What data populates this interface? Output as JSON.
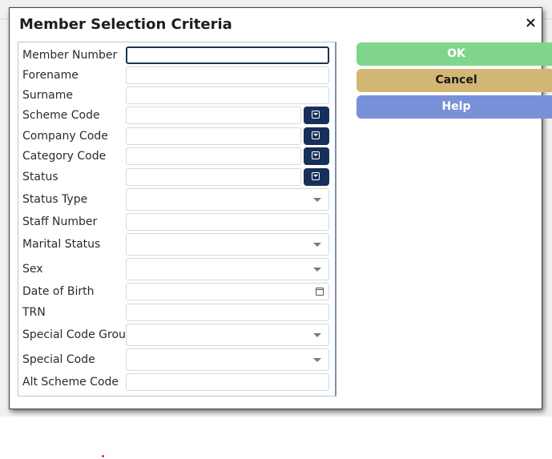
{
  "dialog": {
    "title": "Member Selection Criteria",
    "close_glyph": "×"
  },
  "fields": {
    "member_number": "Member Number",
    "forename": "Forename",
    "surname": "Surname",
    "scheme_code": "Scheme Code",
    "company_code": "Company Code",
    "category_code": "Category Code",
    "status": "Status",
    "status_type": "Status Type",
    "staff_number": "Staff Number",
    "marital_status": "Marital Status",
    "sex": "Sex",
    "date_of_birth": "Date of Birth",
    "trn": "TRN",
    "special_code_group": "Special Code Group",
    "special_code": "Special Code",
    "alt_scheme_code": "Alt Scheme Code"
  },
  "buttons": {
    "ok": "OK",
    "cancel": "Cancel",
    "help": "Help"
  },
  "icons": {
    "lookup": "lookup-list-icon",
    "dropdown": "chevron-down-icon",
    "calendar": "calendar-icon"
  },
  "colors": {
    "ok": "#7fd68a",
    "cancel": "#d3b673",
    "help": "#7891d9",
    "lookup": "#16305a"
  }
}
